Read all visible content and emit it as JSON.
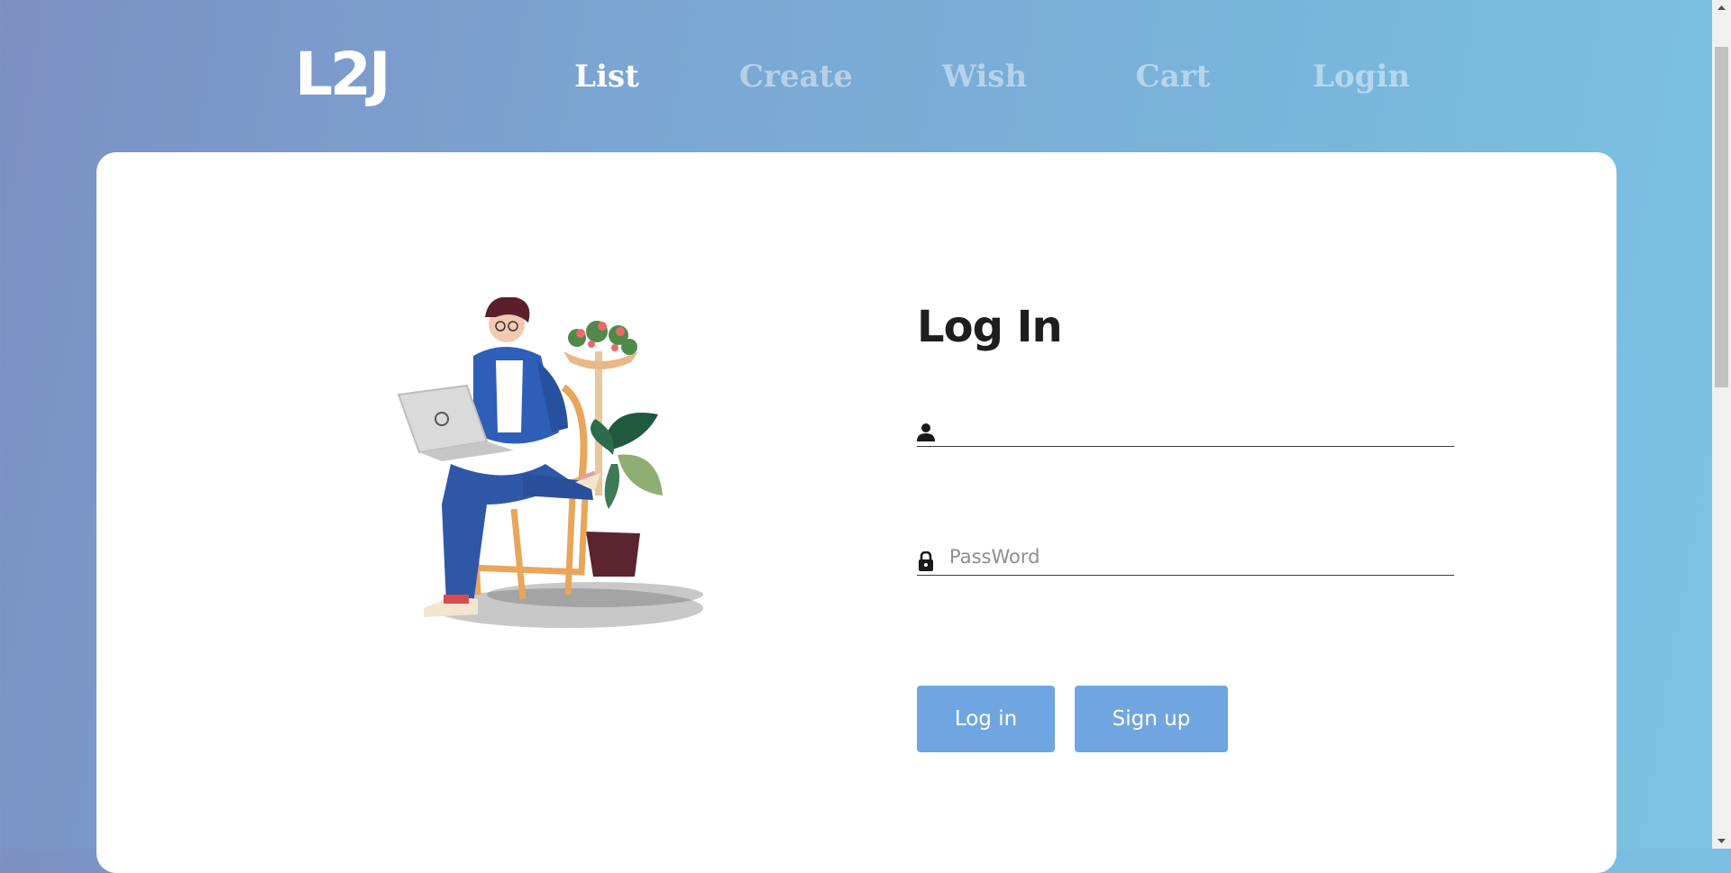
{
  "header": {
    "logo": "L2J",
    "nav": [
      {
        "label": "List",
        "active": true
      },
      {
        "label": "Create",
        "active": false
      },
      {
        "label": "Wish",
        "active": false
      },
      {
        "label": "Cart",
        "active": false
      },
      {
        "label": "Login",
        "active": false
      }
    ]
  },
  "login_form": {
    "title": "Log In",
    "username_icon": "person-icon",
    "username_value": "",
    "password_icon": "lock-icon",
    "password_placeholder": "PassWord",
    "login_button": "Log in",
    "signup_button": "Sign up"
  },
  "colors": {
    "button": "#6fa6e1",
    "card": "#ffffff",
    "title": "#1e1e1e"
  }
}
